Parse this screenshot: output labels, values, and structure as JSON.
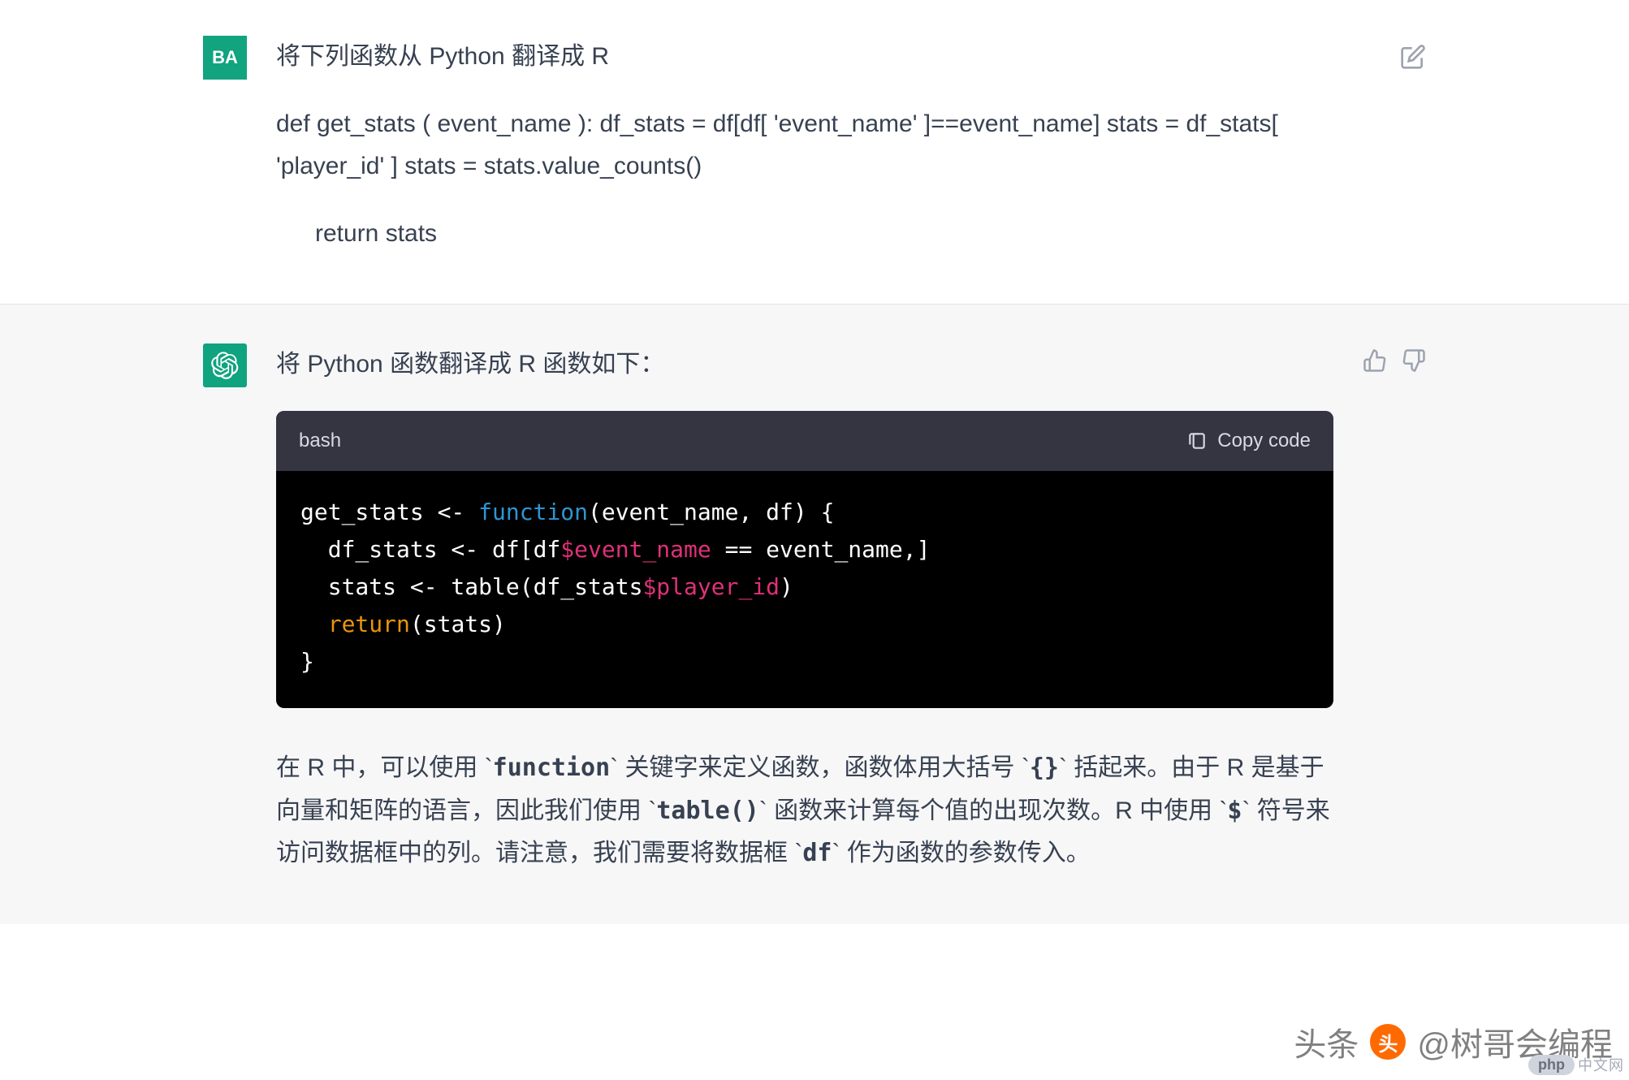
{
  "user": {
    "avatar": "BA",
    "title": "将下列函数从 Python 翻译成 R",
    "body_line1": "def get_stats ( event_name ):      df_stats = df[df[ 'event_name' ]==event_name]      stats = df_stats[ 'player_id' ]      stats = stats.value_counts()",
    "body_line2": "return stats"
  },
  "assistant": {
    "intro": "将 Python 函数翻译成 R 函数如下：",
    "code_lang": "bash",
    "copy_label": "Copy code",
    "code": {
      "l1_a": "get_stats <- ",
      "l1_b": "function",
      "l1_c": "(event_name, df) {",
      "l2_a": "  df_stats <- df[df",
      "l2_b": "$event_name",
      "l2_c": " == event_name,]",
      "l3_a": "  stats <- table(df_stats",
      "l3_b": "$player_id",
      "l3_c": ")",
      "l4_a": "  ",
      "l4_b": "return",
      "l4_c": "(stats)",
      "l5": "}"
    },
    "explain": {
      "p1_a": "在 R 中，可以使用 `",
      "p1_code1": "function",
      "p1_b": "` 关键字来定义函数，函数体用大括号 `",
      "p1_code2": "{}",
      "p1_c": "` 括起来。由于 R 是基于向量和矩阵的语言，因此我们使用 `",
      "p1_code3": "table()",
      "p1_d": "` 函数来计算每个值的出现次数。R 中使用 `",
      "p1_code4": "$",
      "p1_e": "` 符号来访问数据框中的列。请注意，我们需要将数据框 `",
      "p1_code5": "df",
      "p1_f": "` 作为函数的参数传入。"
    }
  },
  "watermark": {
    "prefix": "头条",
    "handle": "@树哥会编程",
    "php": "php",
    "php2": "中文网"
  }
}
